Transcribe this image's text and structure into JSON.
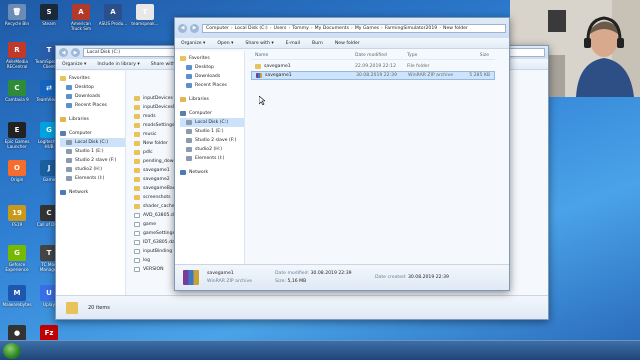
{
  "desktop_icons": [
    {
      "label": "Recycle Bin",
      "color": "#6b8db5",
      "glyph": "🗑"
    },
    {
      "label": "Steam",
      "color": "#1b2838",
      "glyph": "S"
    },
    {
      "label": "American Truck Sim",
      "color": "#b33a2a",
      "glyph": "A"
    },
    {
      "label": "ASUS Produ...",
      "color": "#2b4f8a",
      "glyph": "A"
    },
    {
      "label": "teamspeak...",
      "color": "#e8e8e8",
      "glyph": "T"
    },
    {
      "label": "AVerMedia RECentral",
      "color": "#c0392b",
      "glyph": "R"
    },
    {
      "label": "TeamSpeak 3 Client",
      "color": "#2a5da8",
      "glyph": "T"
    },
    {
      "label": "Camtasia 9",
      "color": "#2e8b3a",
      "glyph": "C"
    },
    {
      "label": "TeamViewer",
      "color": "#1565c0",
      "glyph": "⇄"
    },
    {
      "label": "Epic Games Launcher",
      "color": "#222222",
      "glyph": "E"
    },
    {
      "label": "Logitech G HUB",
      "color": "#00a3e0",
      "glyph": "G"
    },
    {
      "label": "Origin",
      "color": "#f56c2d",
      "glyph": "O"
    },
    {
      "label": "Game",
      "color": "#1a5fa0",
      "glyph": "J"
    },
    {
      "label": "FS19",
      "color": "#c79a1e",
      "glyph": "19"
    },
    {
      "label": "Call of Duty",
      "color": "#333333",
      "glyph": "C"
    },
    {
      "label": "Geforce Experience",
      "color": "#76b900",
      "glyph": "G"
    },
    {
      "label": "TC Mod Manager",
      "color": "#444444",
      "glyph": "T"
    },
    {
      "label": "Malwarebytes",
      "color": "#1f57b0",
      "glyph": "M"
    },
    {
      "label": "Uplay",
      "color": "#3a6ee8",
      "glyph": "U"
    },
    {
      "label": "OBS Studio",
      "color": "#333333",
      "glyph": "●"
    },
    {
      "label": "FileZilla",
      "color": "#bf0000",
      "glyph": "Fz"
    }
  ],
  "back_window": {
    "address": "Local Disk (C:)",
    "toolbar": [
      "Organize ▾",
      "Include in library ▾",
      "Share with ▾"
    ],
    "nav": {
      "favorites": "Favorites",
      "favorite_items": [
        "Desktop",
        "Downloads",
        "Recent Places"
      ],
      "libraries": "Libraries",
      "computer": "Computer",
      "computer_items": [
        "Local Disk (C:)",
        "Studio 1 (E:)",
        "Studio 2 slave (F:)",
        "studio2 (H:)",
        "Elements (I:)"
      ],
      "network": "Network"
    },
    "files": [
      {
        "name": "inputDevices",
        "kind": "folder"
      },
      {
        "name": "inputDevicesMana",
        "kind": "folder"
      },
      {
        "name": "mods",
        "kind": "folder"
      },
      {
        "name": "modsSettings",
        "kind": "folder"
      },
      {
        "name": "music",
        "kind": "folder"
      },
      {
        "name": "New folder",
        "kind": "folder"
      },
      {
        "name": "pdlc",
        "kind": "folder"
      },
      {
        "name": "pending_downloa",
        "kind": "folder"
      },
      {
        "name": "savegame1",
        "kind": "folder"
      },
      {
        "name": "savegame2",
        "kind": "folder"
      },
      {
        "name": "savegameBackup",
        "kind": "folder"
      },
      {
        "name": "screenshots",
        "kind": "folder"
      },
      {
        "name": "shader_cache",
        "kind": "folder"
      },
      {
        "name": "AVD_63805.dat",
        "kind": "file"
      },
      {
        "name": "game",
        "kind": "file"
      },
      {
        "name": "gameSettings",
        "kind": "file"
      },
      {
        "name": "IDT_63805.dat",
        "kind": "file"
      },
      {
        "name": "inputBinding",
        "kind": "file"
      },
      {
        "name": "log",
        "kind": "file"
      },
      {
        "name": "VERSION",
        "kind": "file"
      }
    ],
    "status": "20 items"
  },
  "main_window": {
    "breadcrumb": [
      "Computer",
      "Local Disk (C:)",
      "Users",
      "Tommy",
      "My Documents",
      "My Games",
      "FarmingSimulator2019",
      "New folder"
    ],
    "toolbar": [
      "Organize ▾",
      "Open ▾",
      "Share with ▾",
      "E-mail",
      "Burn",
      "New folder"
    ],
    "nav": {
      "favorites": "Favorites",
      "favorite_items": [
        "Desktop",
        "Downloads",
        "Recent Places"
      ],
      "libraries": "Libraries",
      "computer": "Computer",
      "computer_items": [
        "Local Disk (C:)",
        "Studio 1 (E:)",
        "Studio 2 slave (F:)",
        "studio2 (H:)",
        "Elements (I:)"
      ],
      "network": "Network"
    },
    "columns": [
      "Name",
      "Date modified",
      "Type",
      "Size"
    ],
    "rows": [
      {
        "name": "savegame1",
        "date": "22.09.2019 22:12",
        "type": "File folder",
        "size": "",
        "kind": "folder",
        "selected": false
      },
      {
        "name": "savegame1",
        "date": "30.08.2019 22:39",
        "type": "WinRAR ZIP archive",
        "size": "5 285 KB",
        "kind": "rar",
        "selected": true
      }
    ],
    "details": {
      "name": "savegame1",
      "type": "WinRAR ZIP archive",
      "modified_label": "Date modified:",
      "modified_value": "30.08.2019 22:39",
      "size_label": "Size:",
      "size_value": "5,16 MB",
      "created_label": "Date created:",
      "created_value": "30.08.2019 22:39"
    }
  }
}
